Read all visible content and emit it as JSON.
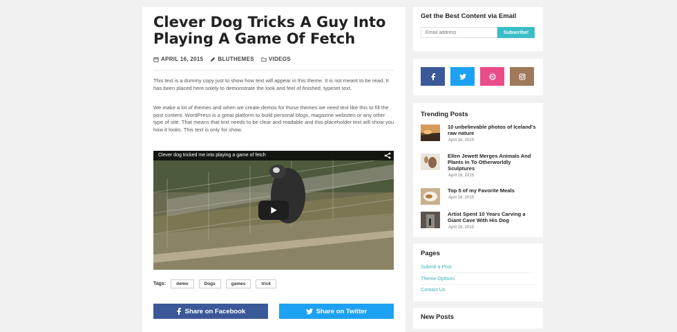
{
  "article": {
    "title": "Clever Dog Tricks A Guy Into Playing A Game Of Fetch",
    "date": "APRIL 16, 2015",
    "author": "BLUTHEMES",
    "category": "VIDEOS",
    "paragraph1": "This text is a dummy copy just to show how text will appear in this theme. It is not meant to be read. It has been placed here solely to demonstrate the look and feel of finished, typeset text.",
    "paragraph2": "We make a lot of themes and when we create demos for those themes we need text like this to fill the post content. WordPress is a great platform to build personal blogs, magazine websites or any other type of site. That means that text needs to be clear and readable and this placeholder text will show you how it looks. This text is only for show.",
    "video_title": "Clever dog tricked me into playing a game of fetch",
    "tags_label": "Tags:",
    "tags": [
      "demo",
      "Dogs",
      "games",
      "trick"
    ],
    "share_facebook": "Share on Facebook",
    "share_twitter": "Share on Twitter"
  },
  "sidebar": {
    "subscribe_title": "Get the Best Content via Email",
    "email_placeholder": "Email address",
    "subscribe_button": "Subscribe!",
    "social": [
      {
        "icon": "facebook-icon",
        "color": "#3b5998"
      },
      {
        "icon": "twitter-icon",
        "color": "#1da1f2"
      },
      {
        "icon": "dribbble-icon",
        "color": "#ea4c89"
      },
      {
        "icon": "instagram-icon",
        "color": "#a0785a"
      }
    ],
    "trending_title": "Trending Posts",
    "trending": [
      {
        "title": "10 unbelievable photos of Iceland's raw nature",
        "date": "April 16, 2015"
      },
      {
        "title": "Ellen Jewett Merges Animals And Plants In To Otherworldly Sculptures",
        "date": "April 16, 2015"
      },
      {
        "title": "Top 5 of my Favorite Meals",
        "date": "April 16, 2015"
      },
      {
        "title": "Artist Spent 10 Years Carving a Giant Cave With His Dog",
        "date": "April 16, 2015"
      }
    ],
    "pages_title": "Pages",
    "pages": [
      "Submit a Post",
      "Theme Options",
      "Contact Us"
    ],
    "new_posts_title": "New Posts"
  }
}
